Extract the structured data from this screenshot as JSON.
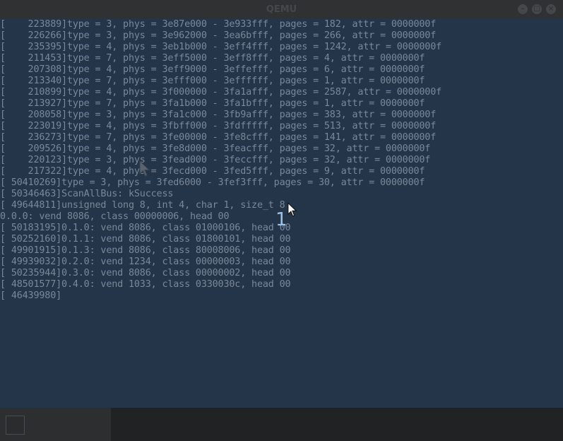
{
  "window": {
    "title": "QEMU",
    "buttons": [
      "–",
      "□",
      "×"
    ]
  },
  "log": {
    "lines": [
      "[    223889]type = 3, phys = 3e87e000 - 3e933fff, pages = 182, attr = 0000000f",
      "[    226266]type = 3, phys = 3e962000 - 3ea6bfff, pages = 266, attr = 0000000f",
      "[    235395]type = 4, phys = 3eb1b000 - 3eff4fff, pages = 1242, attr = 0000000f",
      "[    211453]type = 7, phys = 3eff5000 - 3eff8fff, pages = 4, attr = 0000000f",
      "[    207308]type = 4, phys = 3eff9000 - 3effefff, pages = 6, attr = 0000000f",
      "[    213340]type = 7, phys = 3efff000 - 3effffff, pages = 1, attr = 0000000f",
      "[    210899]type = 4, phys = 3f000000 - 3fa1afff, pages = 2587, attr = 0000000f",
      "[    213927]type = 7, phys = 3fa1b000 - 3fa1bfff, pages = 1, attr = 0000000f",
      "[    208058]type = 3, phys = 3fa1c000 - 3fb9afff, pages = 383, attr = 0000000f",
      "[    223019]type = 4, phys = 3fbff000 - 3fdfffff, pages = 513, attr = 0000000f",
      "[    236273]type = 7, phys = 3fe00000 - 3fe8cfff, pages = 141, attr = 0000000f",
      "[    209526]type = 4, phys = 3fe8d000 - 3feacfff, pages = 32, attr = 0000000f",
      "[    220123]type = 3, phys = 3fead000 - 3feccfff, pages = 32, attr = 0000000f",
      "[    217322]type = 4, phys = 3fecd000 - 3fed5fff, pages = 9, attr = 0000000f",
      "[ 50410269]type = 3, phys = 3fed6000 - 3fef3fff, pages = 30, attr = 0000000f",
      "[ 50346463]ScanAllBus: kSuccess",
      "[ 49644811]unsigned long 8, int 4, char 1, size_t 8",
      "0.0.0: vend 8086, class 00000006, head 00",
      "[ 50183195]0.1.0: vend 8086, class 01000106, head 00",
      "[ 50252160]0.1.1: vend 8086, class 01800101, head 00",
      "[ 49901915]0.1.3: vend 8086, class 80008006, head 00",
      "[ 49939032]0.2.0: vend 1234, class 00000003, head 00",
      "[ 50235944]0.3.0: vend 8086, class 00000002, head 00",
      "[ 48501577]0.4.0: vend 1033, class 0330030c, head 00",
      "[ 46439980]"
    ]
  },
  "overlay_number": "1",
  "colors": {
    "screen_bg": "#243449",
    "text": "#7a8898",
    "titlebar_bg": "#2f3133",
    "taskbar_bg": "#202224",
    "overlay_accent": "#9dc0e6"
  },
  "icons": {
    "cursor_1": "mouse-pointer-icon",
    "cursor_2": "mouse-pointer-icon",
    "taskbar_app": "window-icon"
  }
}
